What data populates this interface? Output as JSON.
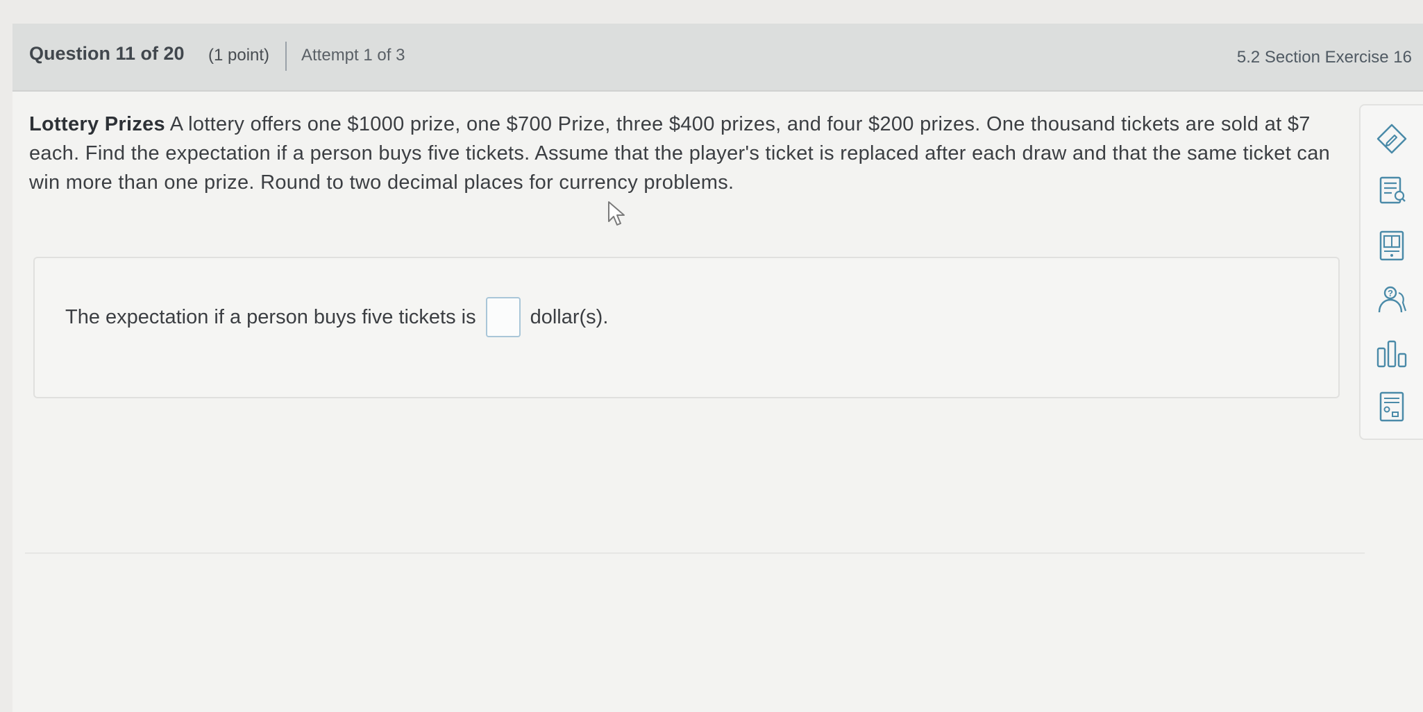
{
  "header": {
    "question_number": "Question 11 of 20",
    "points": "(1 point)",
    "attempt": "Attempt 1 of 3",
    "section": "5.2 Section Exercise 16"
  },
  "problem": {
    "title": "Lottery Prizes",
    "text": " A lottery offers one $1000 prize, one $700 Prize, three $400 prizes, and four $200 prizes. One thousand tickets are sold at $7 each. Find the expectation if a person buys five tickets. Assume that the player's ticket is replaced after each draw and that the same ticket can win more than one prize. Round to two decimal places for currency problems."
  },
  "answer": {
    "prefix": "The expectation if a person buys five tickets is",
    "value": "",
    "suffix": "dollar(s)."
  },
  "toolbar": {
    "icons": [
      "pencil-icon",
      "notes-icon",
      "book-icon",
      "help-icon",
      "chart-icon",
      "calculator-icon"
    ]
  },
  "colors": {
    "header_bg": "#dcdedd",
    "page_bg": "#f3f3f1",
    "input_border": "#a9c6d8",
    "icon_color": "#4a8aa8"
  }
}
